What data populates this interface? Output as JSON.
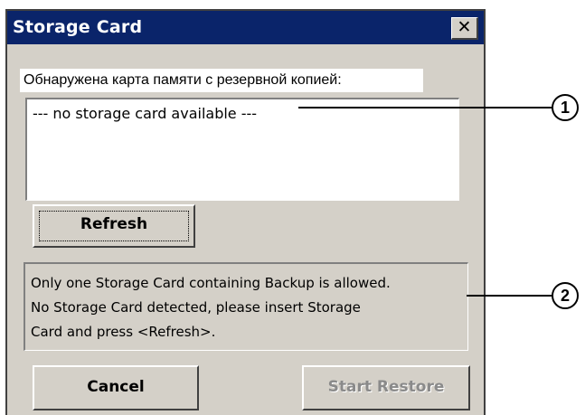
{
  "dialog": {
    "title": "Storage Card",
    "close_icon": "close-icon",
    "close_glyph": "✕"
  },
  "detected_label": "Обнаружена карта памяти с резервной копией:",
  "listbox": {
    "items": [
      "--- no storage card available ---"
    ]
  },
  "buttons": {
    "refresh": "Refresh",
    "cancel": "Cancel",
    "start_restore": "Start Restore"
  },
  "info": {
    "lines": [
      "Only one Storage Card containing Backup is allowed.",
      "No Storage Card detected, please insert Storage",
      "Card and press <Refresh>."
    ]
  },
  "callouts": [
    "1",
    "2"
  ]
}
